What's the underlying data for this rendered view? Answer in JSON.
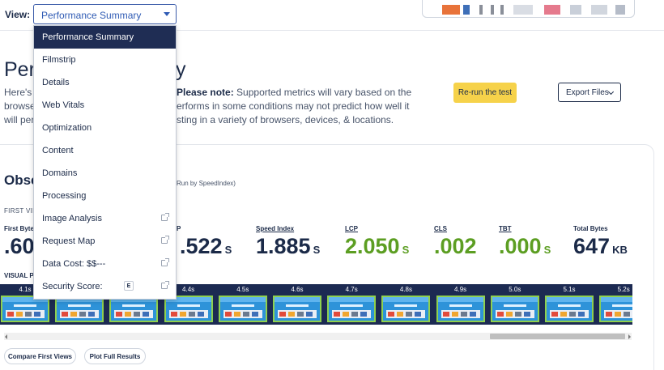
{
  "header": {
    "view_label": "View:",
    "view_selected": "Performance Summary"
  },
  "page": {
    "title_start": "Perf",
    "title_end": "y",
    "intro_lines": [
      {
        "text": "Here's",
        "bold_prefix": ""
      },
      {
        "text": "browse",
        "bold_prefix": ""
      },
      {
        "text": "will per",
        "bold_prefix": ""
      }
    ],
    "note_lines": [
      {
        "bold": "Please note:",
        "text": " Supported metrics will vary based on the"
      },
      {
        "bold": "",
        "text": "erforms in some conditions may not predict how well it"
      },
      {
        "bold": "",
        "text": "sting in a variety of browsers, devices, & locations."
      }
    ],
    "rerun_label": "Re-run the test",
    "export_label": "Export Files"
  },
  "observed": {
    "title": "Obse",
    "run_note": "Run by SpeedIndex)",
    "first_view": "FIRST VIE",
    "visual_progress": "VISUAL P"
  },
  "metrics": [
    {
      "label": "First Byte",
      "value": ".60",
      "unit": "",
      "good": false,
      "underline": false
    },
    {
      "label": "P",
      "value": ".522",
      "unit": "S",
      "good": false,
      "underline": false
    },
    {
      "label": "Speed Index",
      "value": "1.885",
      "unit": "S",
      "good": false,
      "underline": true
    },
    {
      "label": "LCP",
      "value": "2.050",
      "unit": "S",
      "good": true,
      "underline": true
    },
    {
      "label": "CLS",
      "value": ".002",
      "unit": "",
      "good": true,
      "underline": true
    },
    {
      "label": "TBT",
      "value": ".000",
      "unit": "S",
      "good": true,
      "underline": true
    },
    {
      "label": "Total Bytes",
      "value": "647",
      "unit": "KB",
      "good": false,
      "underline": false
    }
  ],
  "filmstrip": {
    "frames": [
      "4.1s",
      "4.2s",
      "4.3s",
      "4.4s",
      "4.5s",
      "4.6s",
      "4.7s",
      "4.8s",
      "4.9s",
      "5.0s",
      "5.1s",
      "5.2s"
    ],
    "visible_from_first": "4.1s",
    "frame_border_color": "#8fd14f",
    "strip_color": "#1c2a52"
  },
  "actions": {
    "compare_label": "Compare First Views",
    "plot_label": "Plot Full Results"
  },
  "menu": {
    "items": [
      {
        "label": "Performance Summary",
        "active": true,
        "external": false
      },
      {
        "label": "Filmstrip",
        "active": false,
        "external": false
      },
      {
        "label": "Details",
        "active": false,
        "external": false
      },
      {
        "label": "Web Vitals",
        "active": false,
        "external": false
      },
      {
        "label": "Optimization",
        "active": false,
        "external": false
      },
      {
        "label": "Content",
        "active": false,
        "external": false
      },
      {
        "label": "Domains",
        "active": false,
        "external": false
      },
      {
        "label": "Processing",
        "active": false,
        "external": false
      },
      {
        "label": "Image Analysis",
        "active": false,
        "external": true
      },
      {
        "label": "Request Map",
        "active": false,
        "external": true
      },
      {
        "label": "Data Cost: $$---",
        "active": false,
        "external": true
      },
      {
        "label": "Security Score:",
        "active": false,
        "external": true,
        "grade": "E"
      }
    ]
  },
  "colors": {
    "accent": "#2f5bb4",
    "good": "#5c9e22",
    "button_yellow": "#f6d24a",
    "navy": "#1b2a48"
  }
}
